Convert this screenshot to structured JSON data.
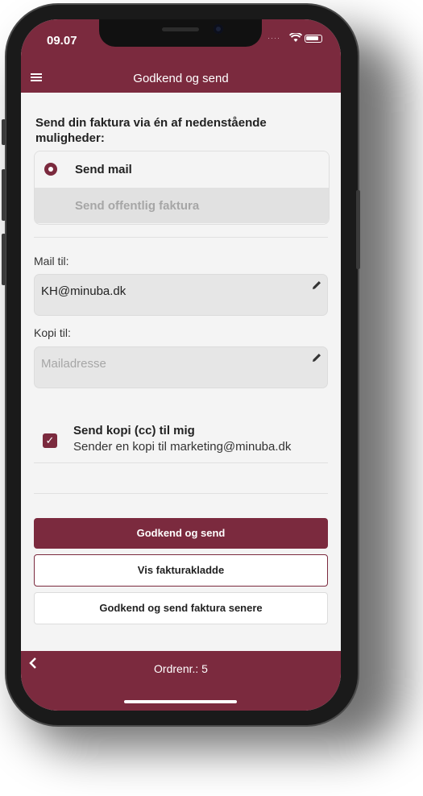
{
  "status_bar": {
    "time": "09.07"
  },
  "nav": {
    "title": "Godkend og send",
    "menu_icon": "hamburger-menu-icon"
  },
  "form": {
    "heading": "Send din faktura via én af nedenstående muligheder:",
    "options": [
      {
        "label": "Send mail",
        "selected": true
      },
      {
        "label": "Send offentlig faktura",
        "selected": false
      }
    ],
    "mail_to": {
      "label": "Mail til:",
      "value": "KH@minuba.dk"
    },
    "cc_to": {
      "label": "Kopi til:",
      "placeholder": "Mailadresse"
    },
    "send_copy": {
      "checked": true,
      "title": "Send kopi (cc) til mig",
      "subtitle": "Sender en kopi til marketing@minuba.dk"
    }
  },
  "actions": {
    "approve_send": "Godkend og send",
    "show_draft": "Vis fakturakladde",
    "approve_later": "Godkend og send faktura senere"
  },
  "footer": {
    "order": "Ordrenr.: 5",
    "back_icon": "chevron-left-icon"
  },
  "colors": {
    "brand": "#7b2a3e",
    "background": "#f4f4f4"
  }
}
